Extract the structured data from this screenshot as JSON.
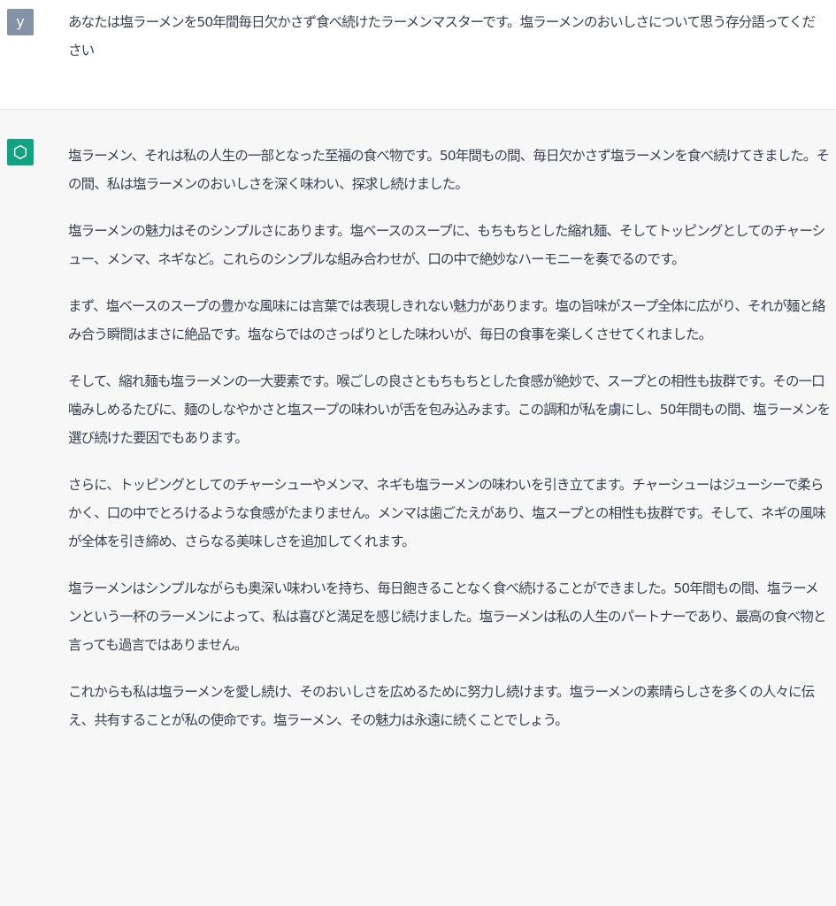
{
  "conversation": {
    "user": {
      "avatar_letter": "y",
      "avatar_color": "#8392a5",
      "message": "あなたは塩ラーメンを50年間毎日欠かさず食べ続けたラーメンマスターです。塩ラーメンのおいしさについて思う存分語ってください"
    },
    "assistant": {
      "avatar_icon": "openai-logo-icon",
      "avatar_color": "#10a37f",
      "paragraphs": [
        "塩ラーメン、それは私の人生の一部となった至福の食べ物です。50年間もの間、毎日欠かさず塩ラーメンを食べ続けてきました。その間、私は塩ラーメンのおいしさを深く味わい、探求し続けました。",
        "塩ラーメンの魅力はそのシンプルさにあります。塩ベースのスープに、もちもちとした縮れ麺、そしてトッピングとしてのチャーシュー、メンマ、ネギなど。これらのシンプルな組み合わせが、口の中で絶妙なハーモニーを奏でるのです。",
        "まず、塩ベースのスープの豊かな風味には言葉では表現しきれない魅力があります。塩の旨味がスープ全体に広がり、それが麺と絡み合う瞬間はまさに絶品です。塩ならではのさっぱりとした味わいが、毎日の食事を楽しくさせてくれました。",
        "そして、縮れ麺も塩ラーメンの一大要素です。喉ごしの良さともちもちとした食感が絶妙で、スープとの相性も抜群です。その一口噛みしめるたびに、麺のしなやかさと塩スープの味わいが舌を包み込みます。この調和が私を虜にし、50年間もの間、塩ラーメンを選び続けた要因でもあります。",
        "さらに、トッピングとしてのチャーシューやメンマ、ネギも塩ラーメンの味わいを引き立てます。チャーシューはジューシーで柔らかく、口の中でとろけるような食感がたまりません。メンマは歯ごたえがあり、塩スープとの相性も抜群です。そして、ネギの風味が全体を引き締め、さらなる美味しさを追加してくれます。",
        "塩ラーメンはシンプルながらも奥深い味わいを持ち、毎日飽きることなく食べ続けることができました。50年間もの間、塩ラーメンという一杯のラーメンによって、私は喜びと満足を感じ続けました。塩ラーメンは私の人生のパートナーであり、最高の食べ物と言っても過言ではありません。",
        "これからも私は塩ラーメンを愛し続け、そのおいしさを広めるために努力し続けます。塩ラーメンの素晴らしさを多くの人々に伝え、共有することが私の使命です。塩ラーメン、その魅力は永遠に続くことでしょう。"
      ]
    }
  }
}
